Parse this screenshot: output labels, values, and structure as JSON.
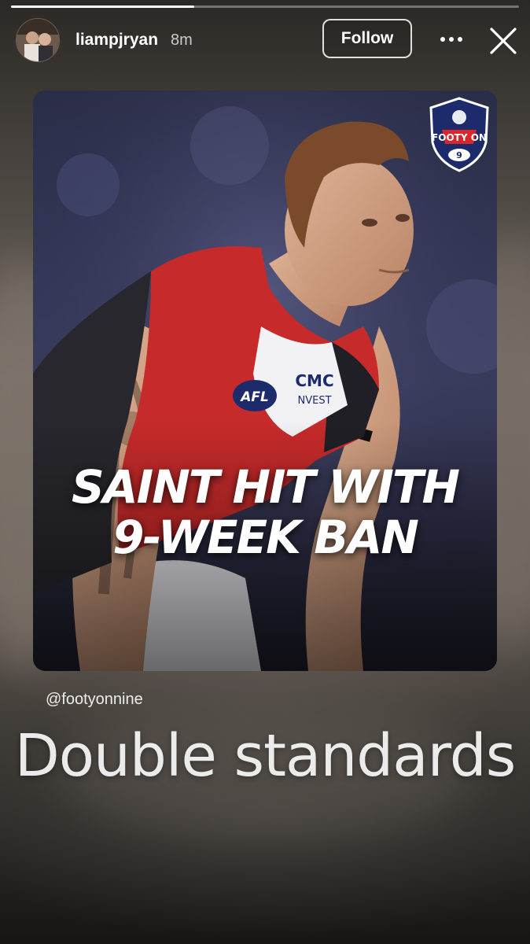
{
  "story": {
    "progress": 0.36,
    "author": {
      "username": "liampjryan",
      "time_ago": "8m",
      "avatar_icon": "profile-photo"
    },
    "header": {
      "follow_label": "Follow",
      "more_icon": "more-horizontal-icon",
      "close_icon": "close-icon"
    },
    "post": {
      "headline_line1": "SAINT HIT WITH",
      "headline_line2": "9-WEEK BAN",
      "logo_text": "FOOTY ON",
      "logo_badge": "9",
      "jersey_text_1": "AFL",
      "jersey_text_2": "CMC",
      "jersey_text_3": "NVEST"
    },
    "mention": "@footyonnine",
    "caption": "Double standards"
  },
  "colors": {
    "accent_red": "#d8262c",
    "logo_navy": "#1c2b6b",
    "text_white": "#ffffff"
  }
}
